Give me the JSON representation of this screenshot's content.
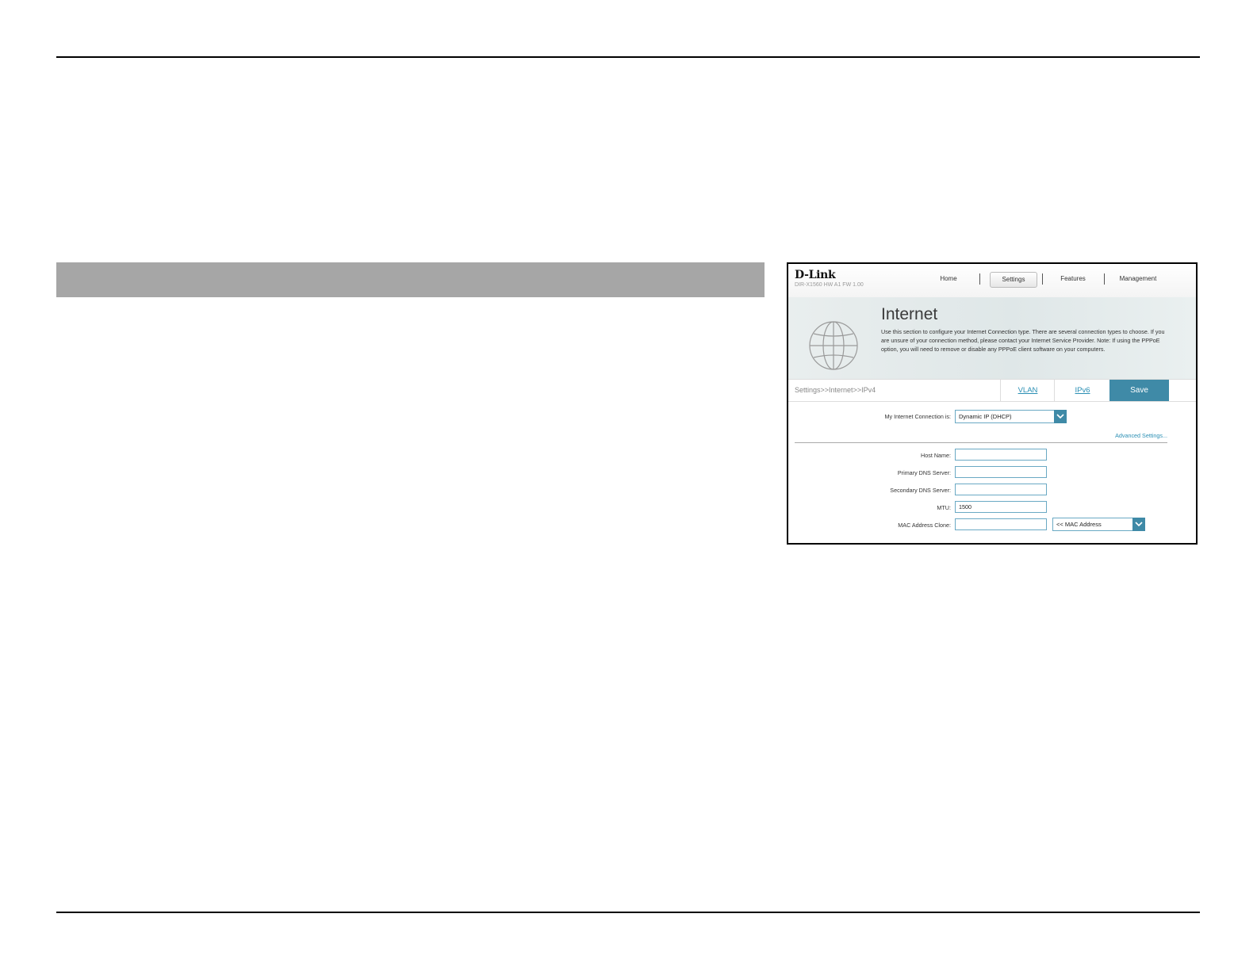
{
  "router_ui": {
    "logo": "D-Link",
    "model": "DIR-X1560 HW A1 FW 1.00",
    "nav": {
      "home": "Home",
      "settings": "Settings",
      "features": "Features",
      "management": "Management"
    },
    "page_title": "Internet",
    "description": "Use this section to configure your Internet Connection type. There are several connection types to choose. If you are unsure of your connection method, please contact your Internet Service Provider. Note: If using the PPPoE option, you will need to remove or disable any PPPoE client software on your computers.",
    "breadcrumb": "Settings>>Internet>>IPv4",
    "tabs": {
      "vlan": "VLAN",
      "ipv6": "IPv6",
      "save": "Save"
    },
    "connection": {
      "label": "My Internet Connection is:",
      "value": "Dynamic IP (DHCP)"
    },
    "advanced_link": "Advanced Settings...",
    "fields": {
      "host_name": {
        "label": "Host Name:",
        "value": ""
      },
      "primary_dns": {
        "label": "Primary DNS Server:",
        "value": ""
      },
      "secondary_dns": {
        "label": "Secondary DNS Server:",
        "value": ""
      },
      "mtu": {
        "label": "MTU:",
        "value": "1500"
      },
      "mac_clone": {
        "label": "MAC Address Clone:",
        "value": "",
        "select_value": "<< MAC Address"
      }
    },
    "colors": {
      "accent": "#3f8aa7",
      "link": "#2a8fb4"
    },
    "icons": [
      "globe-icon",
      "chevron-down-icon"
    ]
  }
}
